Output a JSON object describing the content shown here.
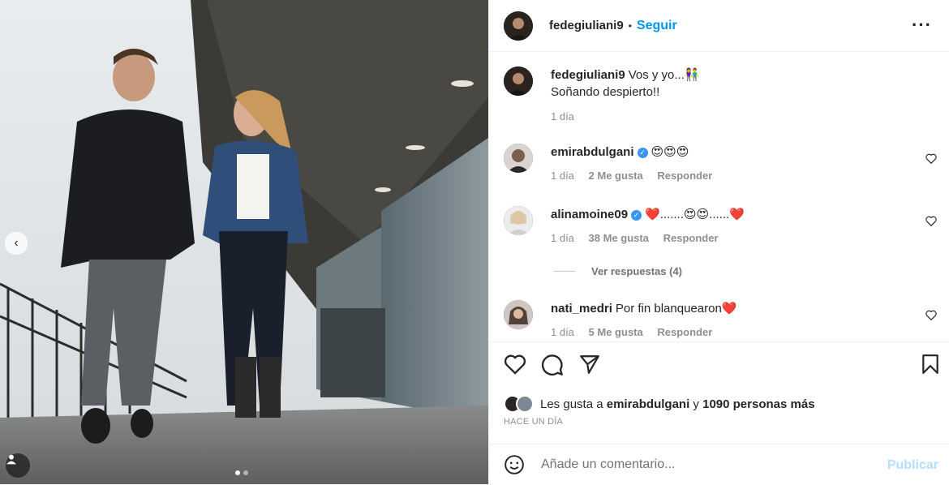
{
  "header": {
    "username": "fedegiuliani9",
    "separator": "•",
    "follow_label": "Seguir",
    "more_icon": "more-horizontal-icon"
  },
  "caption": {
    "username": "fedegiuliani9",
    "text_line1": "Vos y yo...👫",
    "text_line2": "Soñando despierto!!",
    "time": "1 día"
  },
  "comments": [
    {
      "username": "emirabdulgani",
      "verified": true,
      "text": "😍😍😍",
      "time": "1 día",
      "likes": "2 Me gusta",
      "reply": "Responder"
    },
    {
      "username": "alinamoine09",
      "verified": true,
      "text": "❤️.......😍😍......❤️",
      "time": "1 día",
      "likes": "38 Me gusta",
      "reply": "Responder"
    },
    {
      "username": "nati_medri",
      "verified": false,
      "text": "Por fin blanquearon❤️",
      "time": "1 día",
      "likes": "5 Me gusta",
      "reply": "Responder"
    }
  ],
  "view_replies": "Ver respuestas (4)",
  "likes": {
    "prefix": "Les gusta a ",
    "user": "emirabdulgani",
    "middle": " y ",
    "count": "1090 personas más"
  },
  "posted_ago": "HACE UN DÍA",
  "composer": {
    "placeholder": "Añade un comentario...",
    "publish_label": "Publicar"
  },
  "photo_nav": {
    "prev": "‹"
  },
  "colors": {
    "accent": "#0095f6",
    "publish_disabled": "#b2dffc",
    "heart": "#ed4956"
  }
}
